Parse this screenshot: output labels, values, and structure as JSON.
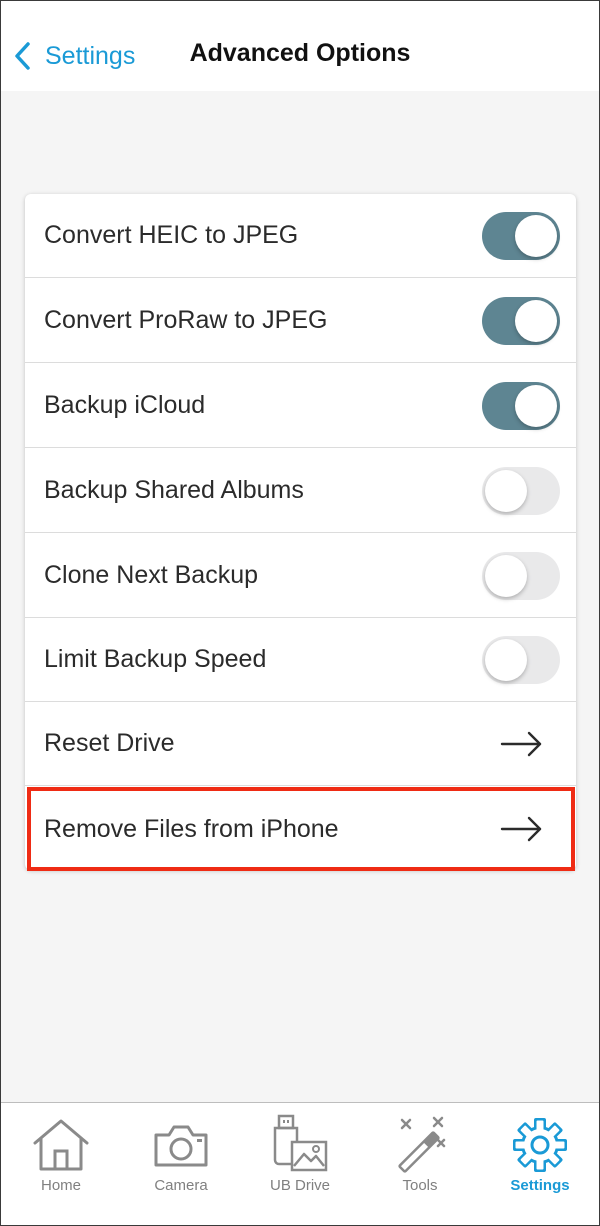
{
  "header": {
    "back_label": "Settings",
    "title": "Advanced Options"
  },
  "options": [
    {
      "label": "Convert HEIC to JPEG",
      "control": "toggle",
      "on": true
    },
    {
      "label": "Convert ProRaw to JPEG",
      "control": "toggle",
      "on": true
    },
    {
      "label": "Backup iCloud",
      "control": "toggle",
      "on": true
    },
    {
      "label": "Backup Shared Albums",
      "control": "toggle",
      "on": false
    },
    {
      "label": "Clone Next Backup",
      "control": "toggle",
      "on": false
    },
    {
      "label": "Limit Backup Speed",
      "control": "toggle",
      "on": false
    },
    {
      "label": "Reset Drive",
      "control": "arrow-right-icon"
    },
    {
      "label": "Remove Files from iPhone",
      "control": "arrow-right-icon",
      "highlighted": true
    }
  ],
  "tabbar": {
    "tabs": [
      {
        "label": "Home",
        "icon": "home-icon"
      },
      {
        "label": "Camera",
        "icon": "camera-icon"
      },
      {
        "label": "UB Drive",
        "icon": "ub-drive-icon"
      },
      {
        "label": "Tools",
        "icon": "magic-wand-icon"
      },
      {
        "label": "Settings",
        "icon": "gear-icon",
        "active": true
      }
    ]
  },
  "colors": {
    "accent": "#1a9ad6",
    "toggle_on": "#5e8592",
    "toggle_off": "#e9e9ea",
    "highlight": "#ef2b14",
    "tab_inactive": "#808080"
  }
}
